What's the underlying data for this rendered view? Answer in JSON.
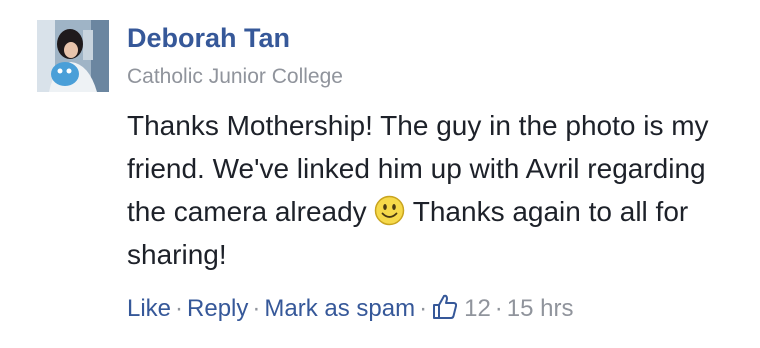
{
  "comment": {
    "author": "Deborah Tan",
    "affiliation": "Catholic Junior College",
    "text_before_emoji": "Thanks Mothership! The guy in the photo is my friend. We've linked him up with Avril regarding the camera already ",
    "emoji": "smiley-emoji",
    "text_after_emoji": " Thanks again to all for sharing!"
  },
  "actions": {
    "like_label": "Like",
    "reply_label": "Reply",
    "spam_label": "Mark as spam",
    "separator": "·",
    "like_count": "12",
    "timestamp": "15 hrs"
  },
  "colors": {
    "link": "#365899",
    "meta": "#90949c",
    "text": "#1d2129"
  }
}
